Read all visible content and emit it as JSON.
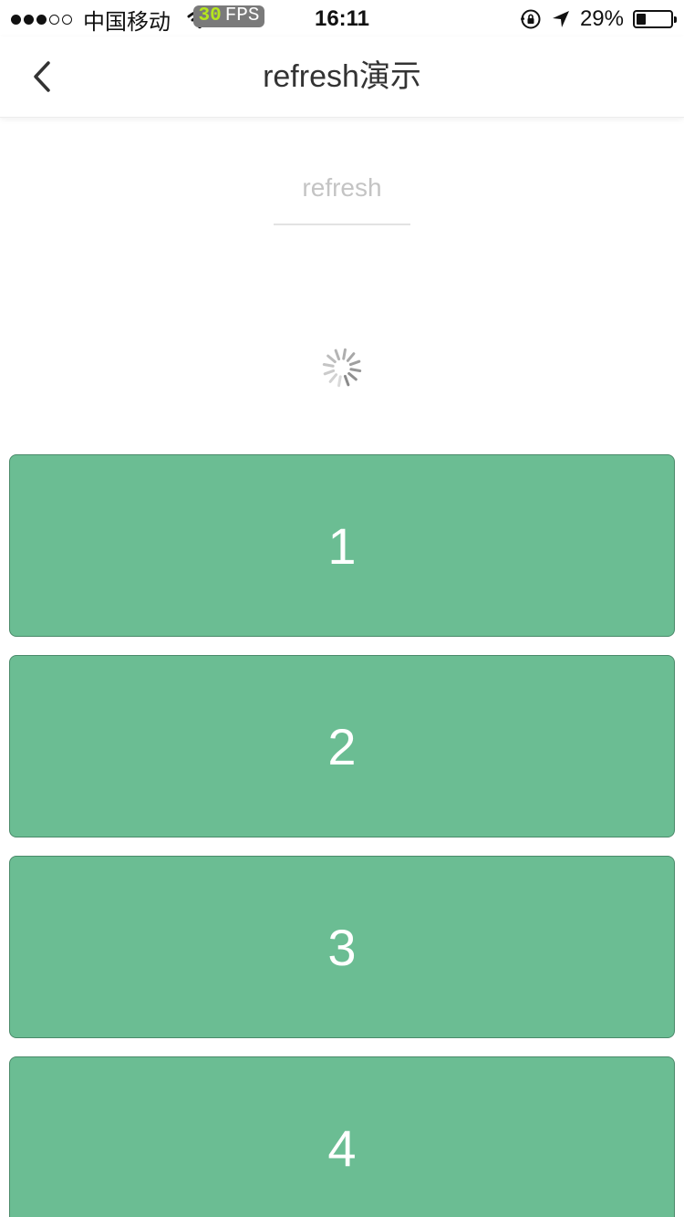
{
  "status_bar": {
    "signal_full": 3,
    "signal_total": 5,
    "carrier": "中国移动",
    "fps_value": "30",
    "fps_label": "FPS",
    "time": "16:11",
    "battery_percent": "29%",
    "battery_level": 0.29,
    "icons": [
      "wifi-icon",
      "orientation-lock-icon",
      "location-arrow-icon",
      "battery-icon"
    ]
  },
  "nav": {
    "title": "refresh演示",
    "back_icon": "chevron-left-icon"
  },
  "refresh": {
    "label": "refresh",
    "spinner_icon": "loading-spinner-icon"
  },
  "list": {
    "items": [
      {
        "label": "1"
      },
      {
        "label": "2"
      },
      {
        "label": "3"
      },
      {
        "label": "4"
      }
    ],
    "card_color": "#6bbd93"
  }
}
